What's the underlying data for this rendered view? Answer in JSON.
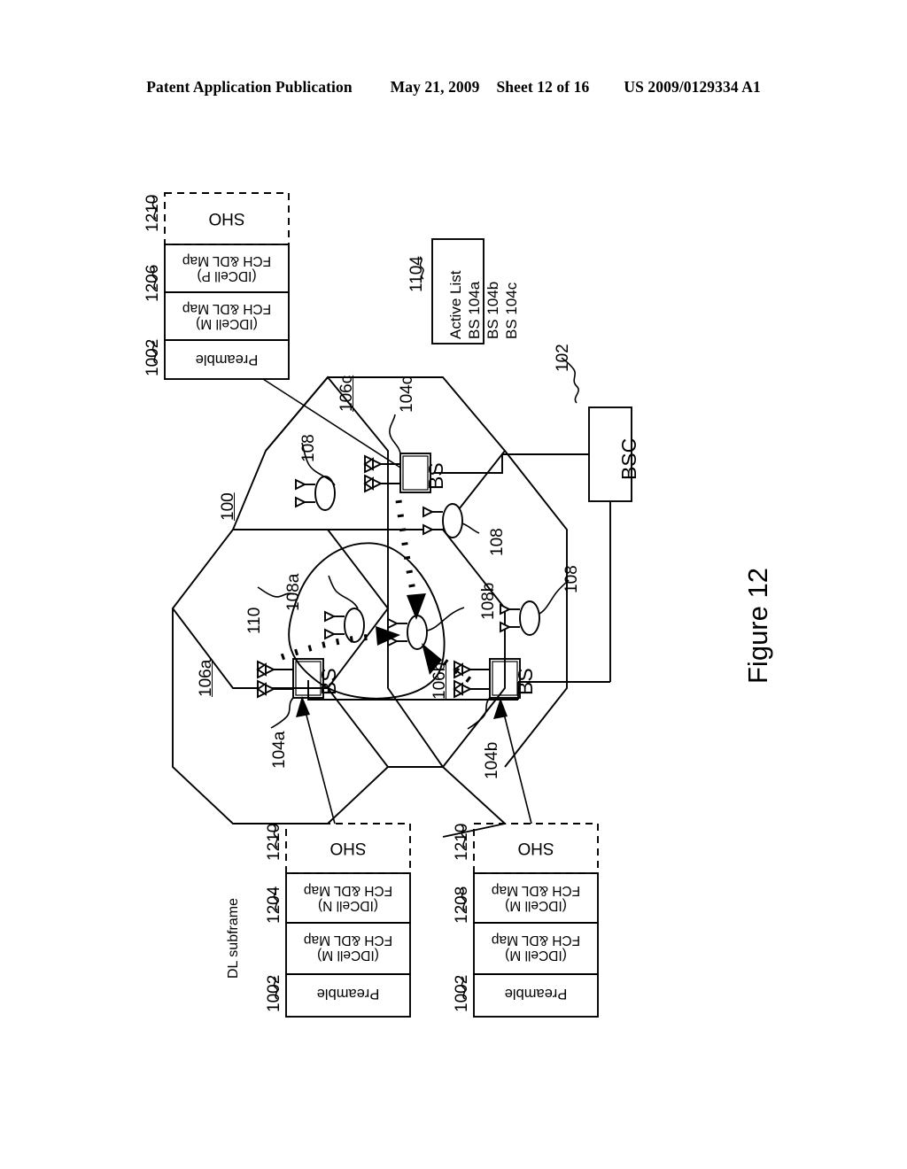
{
  "header": {
    "publication": "Patent Application Publication",
    "date": "May 21, 2009",
    "sheet": "Sheet 12 of 16",
    "patent_number": "US 2009/0129334 A1"
  },
  "figure": {
    "caption": "Figure 12",
    "system_ref": "100"
  },
  "network": {
    "bsc": {
      "label": "BSC",
      "ref": "102"
    },
    "active_list": {
      "ref": "1104",
      "title": "Active List",
      "entries": [
        "BS 104a",
        "BS 104b",
        "BS 104c"
      ]
    },
    "cells": [
      {
        "ref": "106a",
        "bs_label": "BS",
        "bs_ref": "104a"
      },
      {
        "ref": "106b",
        "bs_label": "BS",
        "bs_ref": "104b"
      },
      {
        "ref": "106c",
        "bs_label": "BS",
        "bs_ref": "104c"
      }
    ],
    "mobile_station_ref": "110",
    "antenna_refs": [
      "108",
      "108",
      "108",
      "108",
      "108a",
      "108b"
    ]
  },
  "frames": {
    "dl_subframe_label": "DL subframe",
    "top": {
      "preamble": {
        "ref": "1002",
        "label": "Preamble"
      },
      "fields": [
        {
          "line1": "FCH &DL Map",
          "line2": "(IDCell M)"
        },
        {
          "ref": "1206",
          "line1": "FCH &DL Map",
          "line2": "(IDCell P)"
        }
      ],
      "sho": {
        "ref": "1210",
        "label": "SHO"
      }
    },
    "bottom_left": {
      "preamble": {
        "ref": "1002",
        "label": "Preamble"
      },
      "fields": [
        {
          "line1": "FCH &DL Map",
          "line2": "(IDCell M)"
        },
        {
          "ref": "1204",
          "line1": "FCH &DL Map",
          "line2": "(IDCell N)"
        }
      ],
      "sho": {
        "ref": "1210",
        "label": "SHO"
      }
    },
    "bottom_right": {
      "preamble": {
        "ref": "1002",
        "label": "Preamble"
      },
      "fields": [
        {
          "line1": "FCH &DL Map",
          "line2": "(IDCell M)"
        },
        {
          "ref": "1208",
          "line1": "FCH &DL Map",
          "line2": "(IDCell M)"
        }
      ],
      "sho": {
        "ref": "1210",
        "label": "SHO"
      }
    }
  },
  "colors": {
    "ink": "#000000",
    "paper": "#ffffff"
  }
}
